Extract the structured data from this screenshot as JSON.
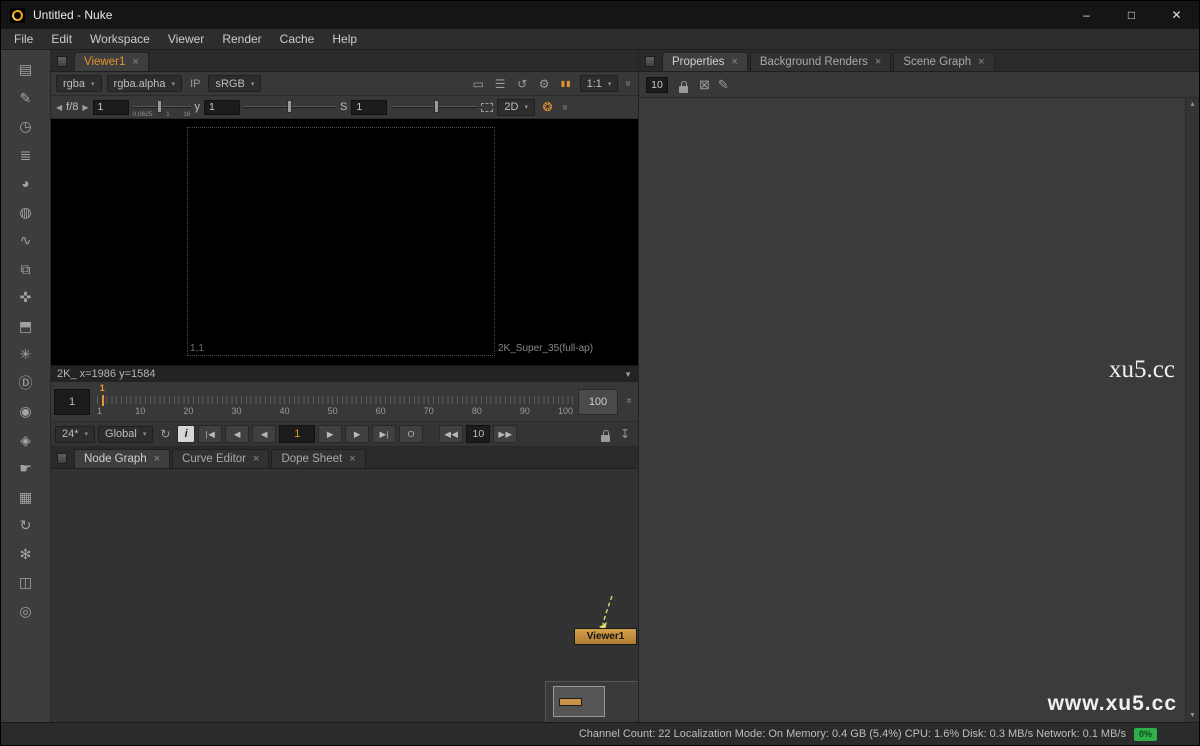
{
  "ui": {
    "close": "×",
    "caret": "▾",
    "caret_down": "▼",
    "chevron_more": "»",
    "scroll_up": "▲",
    "scroll_down": "▼",
    "arrow_left": "◀",
    "arrow_right": "▶"
  },
  "titlebar": {
    "title": "Untitled - Nuke",
    "minimize": "–",
    "maximize": "□",
    "close": "✕"
  },
  "menubar": {
    "items": [
      "File",
      "Edit",
      "Workspace",
      "Viewer",
      "Render",
      "Cache",
      "Help"
    ]
  },
  "left_toolbar": {
    "icons": [
      {
        "name": "image",
        "glyph": "▤"
      },
      {
        "name": "draw",
        "glyph": "✎"
      },
      {
        "name": "time",
        "glyph": "◷"
      },
      {
        "name": "channel",
        "glyph": "≣"
      },
      {
        "name": "color",
        "glyph": "◕"
      },
      {
        "name": "filter",
        "glyph": "◍"
      },
      {
        "name": "keyer",
        "glyph": "∿"
      },
      {
        "name": "merge",
        "glyph": "⧉"
      },
      {
        "name": "transform",
        "glyph": "✜"
      },
      {
        "name": "3d",
        "glyph": "⬒"
      },
      {
        "name": "particles",
        "glyph": "✳"
      },
      {
        "name": "deep",
        "glyph": "Ⓓ"
      },
      {
        "name": "views",
        "glyph": "◉"
      },
      {
        "name": "metadata",
        "glyph": "◈"
      },
      {
        "name": "toolsets",
        "glyph": "☛"
      },
      {
        "name": "other",
        "glyph": "▦"
      },
      {
        "name": "update",
        "glyph": "↻"
      },
      {
        "name": "effects",
        "glyph": "✻"
      },
      {
        "name": "storage",
        "glyph": "◫"
      },
      {
        "name": "settings",
        "glyph": "◎"
      }
    ]
  },
  "viewer": {
    "tab": "Viewer1",
    "channels": "rgba",
    "layer": "rgba.alpha",
    "input_process": "IP",
    "lut": "sRGB",
    "zoom": "1:1",
    "fstop": "f/8",
    "gain_value": "1",
    "gain_ticks": [
      "0.0625",
      "1",
      "16"
    ],
    "gamma_label": "y",
    "gamma_value": "1",
    "saturation_label": "S",
    "saturation_value": "1",
    "view_mode": "2D",
    "format_origin": "1,1",
    "format_name": "2K_Super_35(full-ap)",
    "info_text": "2K_  x=1986 y=1584",
    "icons": {
      "monitor": "▭",
      "list": "☰",
      "sync": "↺",
      "gear": "⚙",
      "pause": "▮▮",
      "wheel": "❂"
    }
  },
  "timeline": {
    "start": "1",
    "end": "100",
    "playhead": "1",
    "ticks": [
      "1",
      "10",
      "20",
      "30",
      "40",
      "50",
      "60",
      "70",
      "80",
      "90",
      "100"
    ]
  },
  "playback": {
    "fps": "24*",
    "range": "Global",
    "current": "1",
    "increment": "10",
    "icons": {
      "loop": "↻",
      "info": "i",
      "to_start": "|◀",
      "prev_key": "◀",
      "step_back": "◀",
      "play": "▶",
      "step_fwd": "▶",
      "to_end": "▶|",
      "once": "O",
      "jump_back": "◀◀",
      "jump_fwd": "▶▶",
      "render": "↧"
    }
  },
  "node_graph": {
    "tabs": [
      "Node Graph",
      "Curve Editor",
      "Dope Sheet"
    ],
    "node_label": "Viewer1"
  },
  "properties": {
    "tabs": [
      "Properties",
      "Background Renders",
      "Scene Graph"
    ],
    "max_panels": "10",
    "icons": {
      "clear": "⊠",
      "edit": "✎"
    }
  },
  "statusbar": {
    "text": "Channel Count: 22  Localization Mode: On  Memory: 0.4 GB (5.4%)  CPU: 1.6% Disk: 0.3 MB/s Network: 0.1 MB/s",
    "badge": "0%"
  },
  "watermarks": {
    "center": "xu5.cc",
    "bottom": "www.xu5.cc"
  },
  "colors": {
    "accent": "#e8962e",
    "node": "#c99245",
    "badge": "#2fae4a"
  }
}
